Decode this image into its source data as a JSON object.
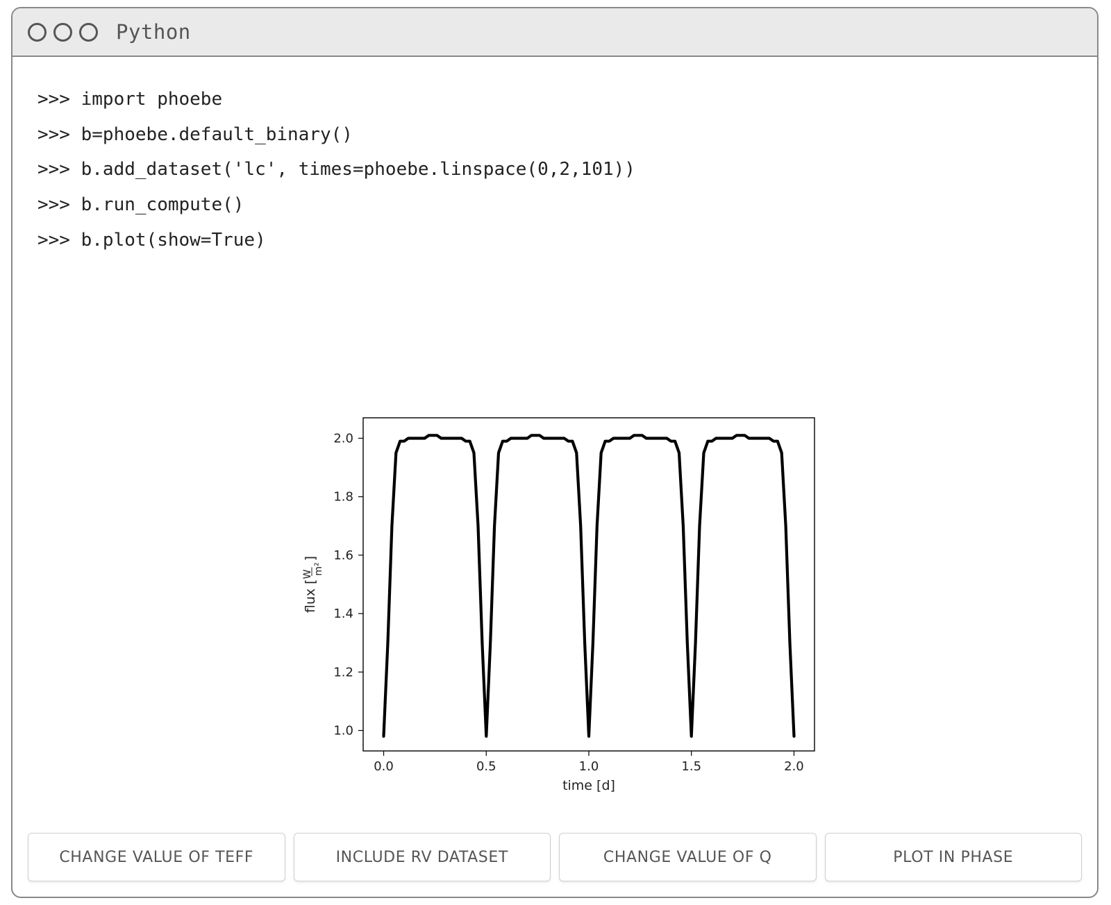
{
  "window": {
    "title": "Python"
  },
  "console": {
    "prompt": ">>>",
    "lines": [
      "import phoebe",
      "b=phoebe.default_binary()",
      "b.add_dataset('lc', times=phoebe.linspace(0,2,101))",
      "b.run_compute()",
      "b.plot(show=True)"
    ]
  },
  "buttons": [
    {
      "label": "CHANGE VALUE OF TEFF"
    },
    {
      "label": "INCLUDE RV DATASET"
    },
    {
      "label": "CHANGE VALUE OF Q"
    },
    {
      "label": "PLOT IN PHASE"
    }
  ],
  "chart_data": {
    "type": "line",
    "title": "",
    "xlabel": "time [d]",
    "ylabel": "flux [W/m²]",
    "ylabel_html": "flux [<tspan text-decoration='underline'>W</tspan>⁄m²]",
    "xlim": [
      -0.1,
      2.1
    ],
    "ylim": [
      0.93,
      2.07
    ],
    "xticks": [
      0.0,
      0.5,
      1.0,
      1.5,
      2.0
    ],
    "yticks": [
      1.0,
      1.2,
      1.4,
      1.6,
      1.8,
      2.0
    ],
    "x": [
      0.0,
      0.02,
      0.04,
      0.06,
      0.08,
      0.1,
      0.12,
      0.14,
      0.16,
      0.18,
      0.2,
      0.22,
      0.24,
      0.26,
      0.28,
      0.3,
      0.32,
      0.34,
      0.36,
      0.38,
      0.4,
      0.42,
      0.44,
      0.46,
      0.48,
      0.5,
      0.52,
      0.54,
      0.56,
      0.58,
      0.6,
      0.62,
      0.64,
      0.66,
      0.68,
      0.7,
      0.72,
      0.74,
      0.76,
      0.78,
      0.8,
      0.82,
      0.84,
      0.86,
      0.88,
      0.9,
      0.92,
      0.94,
      0.96,
      0.98,
      1.0,
      1.02,
      1.04,
      1.06,
      1.08,
      1.1,
      1.12,
      1.14,
      1.16,
      1.18,
      1.2,
      1.22,
      1.24,
      1.26,
      1.28,
      1.3,
      1.32,
      1.34,
      1.36,
      1.38,
      1.4,
      1.42,
      1.44,
      1.46,
      1.48,
      1.5,
      1.52,
      1.54,
      1.56,
      1.58,
      1.6,
      1.62,
      1.64,
      1.66,
      1.68,
      1.7,
      1.72,
      1.74,
      1.76,
      1.78,
      1.8,
      1.82,
      1.84,
      1.86,
      1.88,
      1.9,
      1.92,
      1.94,
      1.96,
      1.98,
      2.0
    ],
    "values": [
      0.98,
      1.3,
      1.7,
      1.95,
      1.99,
      1.99,
      2.0,
      2.0,
      2.0,
      2.0,
      2.0,
      2.01,
      2.01,
      2.01,
      2.0,
      2.0,
      2.0,
      2.0,
      2.0,
      2.0,
      1.99,
      1.99,
      1.95,
      1.7,
      1.3,
      0.98,
      1.3,
      1.7,
      1.95,
      1.99,
      1.99,
      2.0,
      2.0,
      2.0,
      2.0,
      2.0,
      2.01,
      2.01,
      2.01,
      2.0,
      2.0,
      2.0,
      2.0,
      2.0,
      2.0,
      1.99,
      1.99,
      1.95,
      1.7,
      1.3,
      0.98,
      1.3,
      1.7,
      1.95,
      1.99,
      1.99,
      2.0,
      2.0,
      2.0,
      2.0,
      2.0,
      2.01,
      2.01,
      2.01,
      2.0,
      2.0,
      2.0,
      2.0,
      2.0,
      2.0,
      1.99,
      1.99,
      1.95,
      1.7,
      1.3,
      0.98,
      1.3,
      1.7,
      1.95,
      1.99,
      1.99,
      2.0,
      2.0,
      2.0,
      2.0,
      2.0,
      2.01,
      2.01,
      2.01,
      2.0,
      2.0,
      2.0,
      2.0,
      2.0,
      2.0,
      1.99,
      1.99,
      1.95,
      1.7,
      1.3,
      0.98
    ]
  }
}
